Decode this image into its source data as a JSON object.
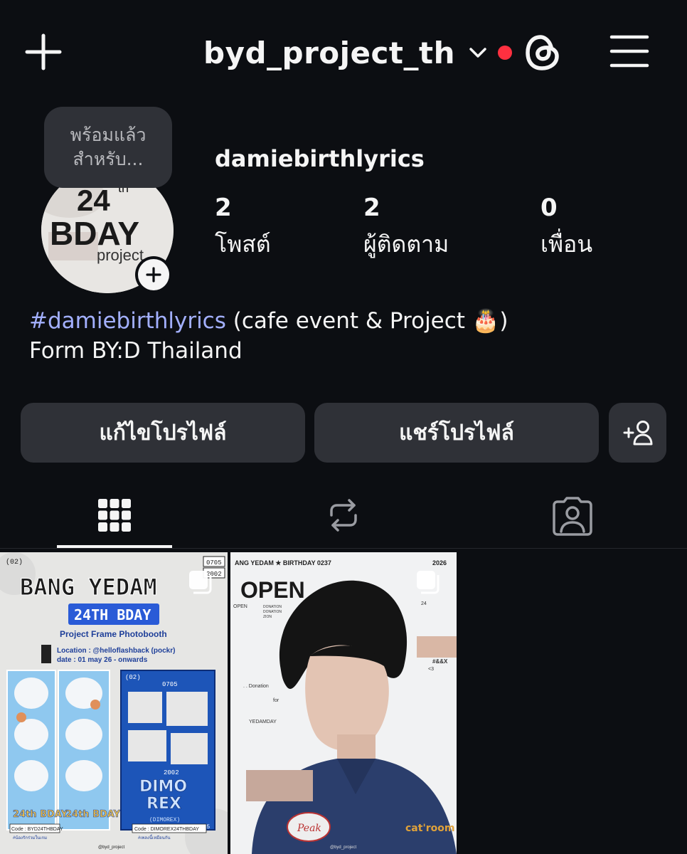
{
  "header": {
    "username": "byd_project_th",
    "icons": {
      "create": "plus-icon",
      "account_switch": "chevron-down-icon",
      "threads": "threads-icon",
      "menu": "hamburger-menu-icon"
    },
    "notification_dot_color": "#ff3040"
  },
  "profile": {
    "note": {
      "line1": "พร้อมแล้ว",
      "line2": "สำหรับ..."
    },
    "avatar": {
      "line1": "24",
      "line1_sup": "th",
      "line2": "BDAY",
      "line3": "project",
      "add_icon": "plus-icon"
    },
    "name": "damiebirthlyrics",
    "stats": [
      {
        "value": "2",
        "label": "โพสต์"
      },
      {
        "value": "2",
        "label": "ผู้ติดตาม"
      },
      {
        "value": "0",
        "label": "เพื่อน"
      }
    ],
    "bio": {
      "hashtag": "#damiebirthlyrics",
      "rest": " (cafe event & Project 🎂)",
      "line2": "Form BY:D Thailand"
    }
  },
  "actions": {
    "edit_profile": "แก้ไขโปรไฟล์",
    "share_profile": "แชร์โปรไฟล์",
    "discover_people_icon": "add-person-icon"
  },
  "tabs": [
    {
      "name": "grid",
      "icon": "grid-icon",
      "active": true
    },
    {
      "name": "reposts",
      "icon": "repost-icon",
      "active": false
    },
    {
      "name": "tagged",
      "icon": "tagged-person-icon",
      "active": false
    }
  ],
  "posts": [
    {
      "kind": "poster",
      "corner_tl": "(02)",
      "corner_tr1": "0705",
      "corner_tr2": "2002",
      "title": "BANG YEDAM",
      "badge": "24TH BDAY",
      "subtitle": "Project Frame Photobooth",
      "location": "Location : @helloflashback (pockr)",
      "date": "date :  01 may 26 - onwards",
      "frame_label_a": "24th BDAY",
      "frame_label_b": "24th BDAY",
      "dimo_top": "(02)",
      "dimo_code1": "0705",
      "dimo_code2": "2002",
      "dimo_word": "DIMO",
      "rex_word": "REX",
      "dimo_small": "(DIMOREX)",
      "dimo_code3": "0705",
      "code_left": "Code : BYD24THBDAY",
      "code_right": "Code : DIMOREX24THBDAY",
      "foot_left": "#น้องรักร่วมในเกม",
      "foot_right": "#เพลงนี้เหมือนกัน",
      "credit": "@byd_project",
      "multi_icon": "multiple-images-icon"
    },
    {
      "kind": "photo",
      "header_text": "ANG YEDAM  ★  BIRTHDAY   0237",
      "year": "2026",
      "open_word": "OPEN",
      "small_open": "OPEN",
      "donation_lines": [
        "DONATION",
        "DONATION",
        "ZION"
      ],
      "side_number": "24",
      "donation_text": ". . Donation",
      "for_text": "for",
      "yedamday": "YEDAMDAY",
      "heart_text": "<3",
      "hash_text": "#&&X",
      "patch_text": "Peak",
      "catroom_text": "cat'room",
      "credit": "@byd_project",
      "multi_icon": "multiple-images-icon"
    }
  ]
}
